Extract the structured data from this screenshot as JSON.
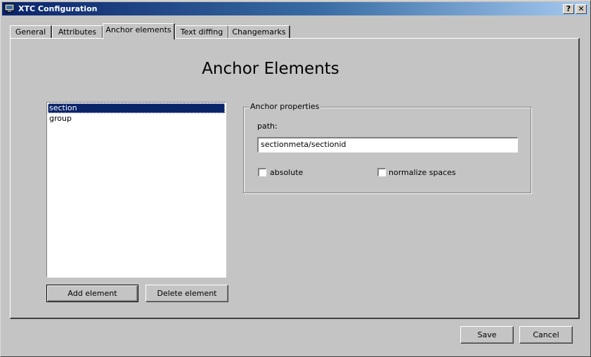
{
  "window": {
    "title": "XTC Configuration",
    "help_glyph": "?",
    "close_glyph": "✕",
    "app_icon": "monitor-icon"
  },
  "tabs": [
    {
      "label": "General",
      "active": false
    },
    {
      "label": "Attributes",
      "active": false
    },
    {
      "label": "Anchor elements",
      "active": true
    },
    {
      "label": "Text diffing",
      "active": false
    },
    {
      "label": "Changemarks",
      "active": false
    }
  ],
  "page": {
    "heading": "Anchor Elements"
  },
  "element_list": {
    "items": [
      "section",
      "group"
    ],
    "selected": "section"
  },
  "list_buttons": {
    "add_label": "Add element",
    "delete_label": "Delete element"
  },
  "anchor_properties": {
    "group_title": "Anchor properties",
    "path_label": "path:",
    "path_value": "sectionmeta/sectionid",
    "absolute_label": "absolute",
    "absolute_checked": false,
    "normalize_label": "normalize spaces",
    "normalize_checked": false
  },
  "dialog_buttons": {
    "save_label": "Save",
    "cancel_label": "Cancel"
  },
  "colors": {
    "titlebar_start": "#0a246a",
    "titlebar_end": "#a6caf0",
    "selection": "#0a246a",
    "face": "#c4c4c4"
  }
}
